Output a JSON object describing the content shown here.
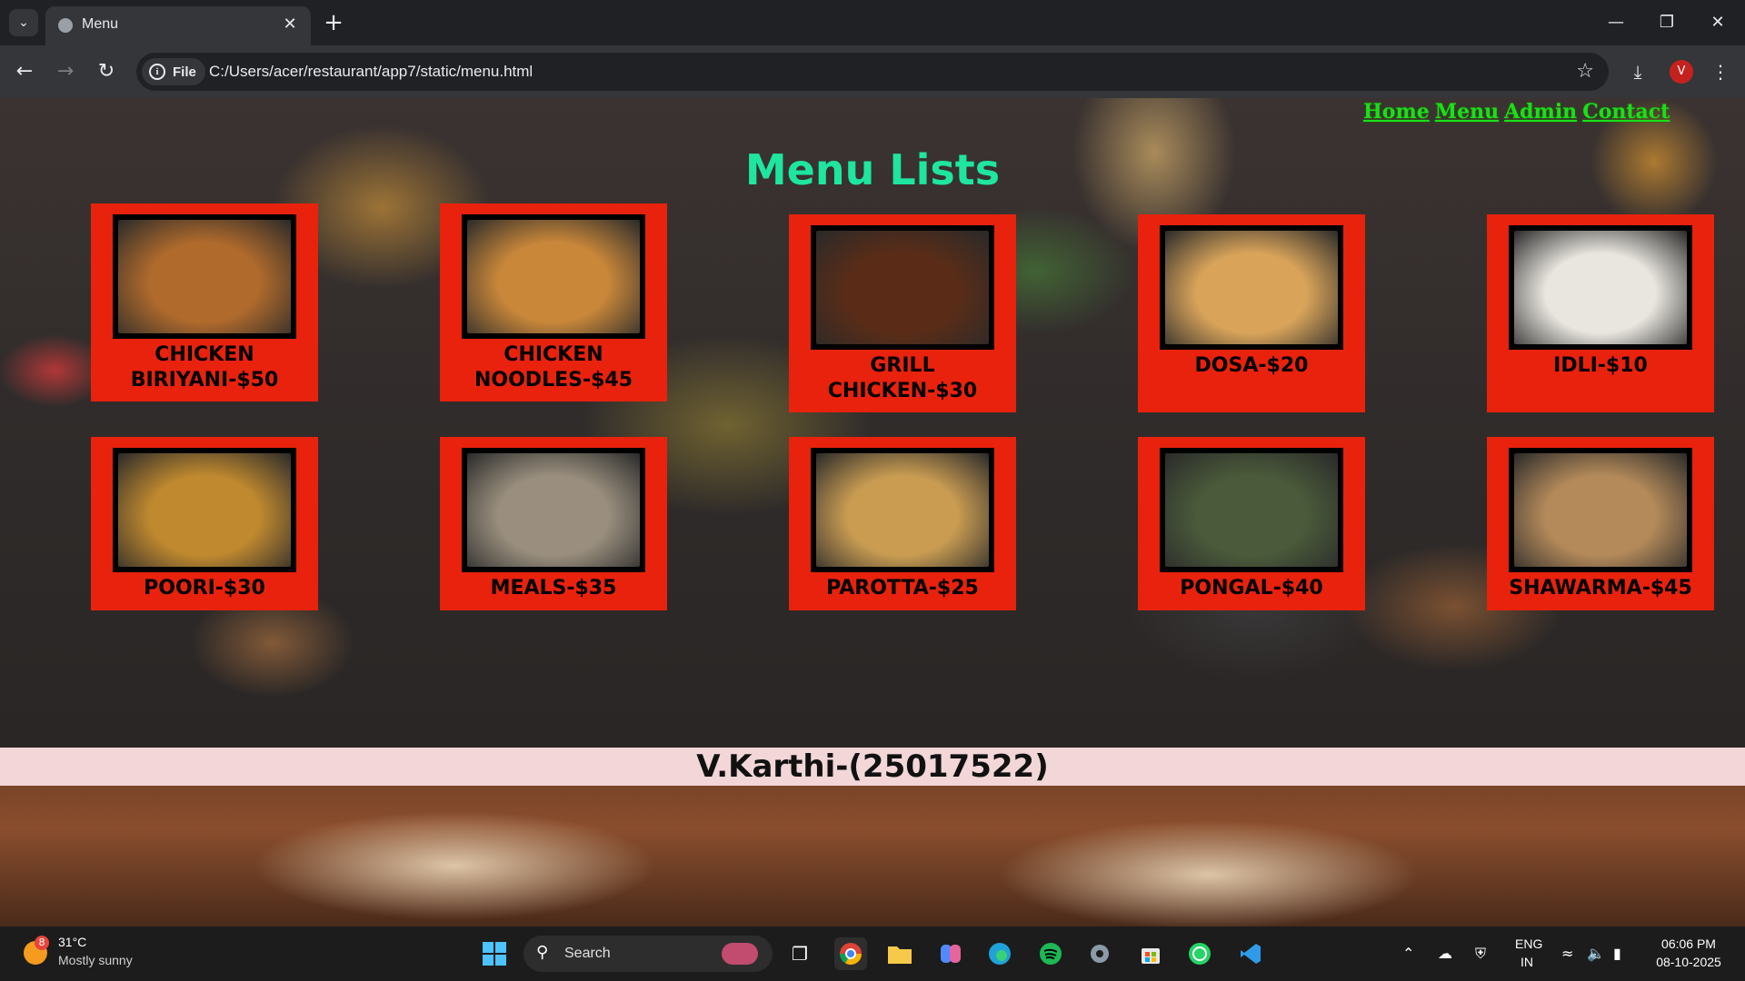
{
  "browser": {
    "tab_title": "Menu",
    "url_chip": "File",
    "url": "C:/Users/acer/restaurant/app7/static/menu.html",
    "profile_initial": "V"
  },
  "page": {
    "nav": [
      "Home",
      "Menu",
      "Admin",
      "Contact"
    ],
    "title": "Menu Lists",
    "items": [
      {
        "name": "CHICKEN BIRIYANI-$50",
        "photo_color": "#b06a2c"
      },
      {
        "name": "CHICKEN NOODLES-$45",
        "photo_color": "#c9873a"
      },
      {
        "name": "GRILL CHICKEN-$30",
        "photo_color": "#5a2c17"
      },
      {
        "name": "DOSA-$20",
        "photo_color": "#d9a45a"
      },
      {
        "name": "IDLI-$10",
        "photo_color": "#e9e6df"
      },
      {
        "name": "POORI-$30",
        "photo_color": "#c0892f"
      },
      {
        "name": "MEALS-$35",
        "photo_color": "#9a8f7e"
      },
      {
        "name": "PAROTTA-$25",
        "photo_color": "#c99c52"
      },
      {
        "name": "PONGAL-$40",
        "photo_color": "#4a5a3a"
      },
      {
        "name": "SHAWARMA-$45",
        "photo_color": "#b48a5a"
      }
    ],
    "footer": "V.Karthi-(25017522)"
  },
  "taskbar": {
    "weather_badge": "8",
    "temperature": "31°C",
    "condition": "Mostly sunny",
    "search_label": "Search",
    "lang_primary": "ENG",
    "lang_region": "IN",
    "time": "06:06 PM",
    "date": "08-10-2025"
  }
}
